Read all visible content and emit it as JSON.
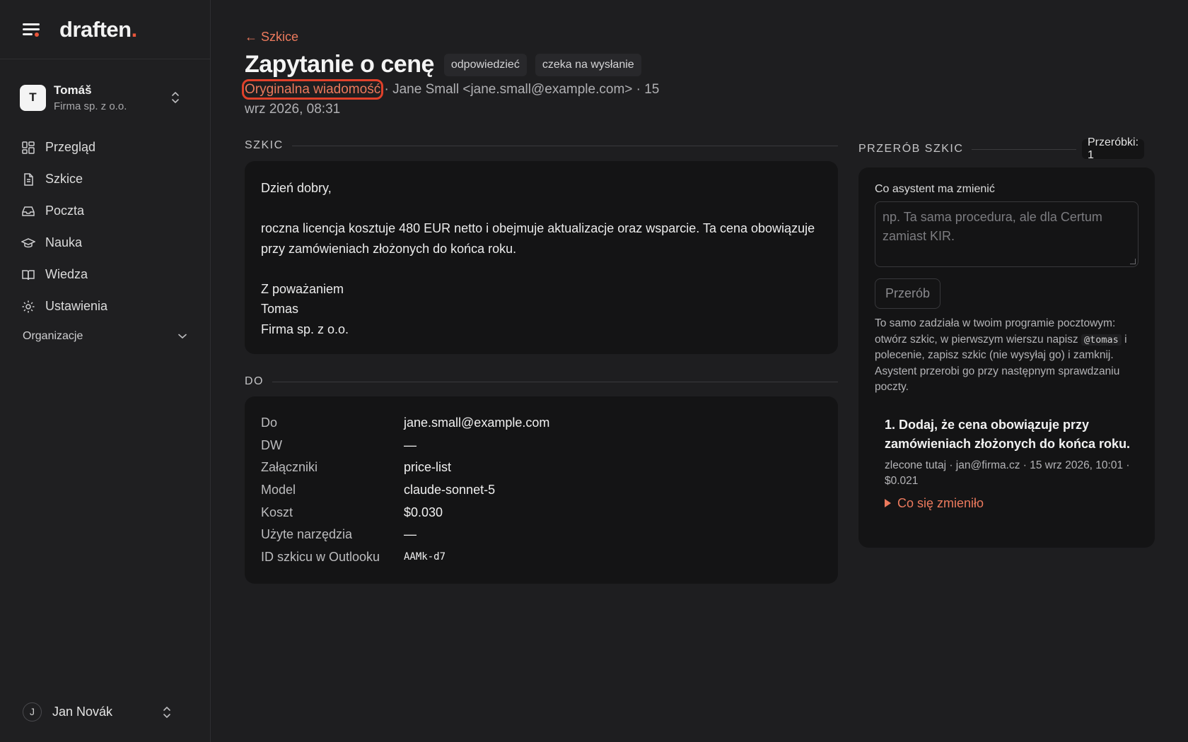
{
  "app": {
    "logo": "draften",
    "logo_dot": "."
  },
  "org": {
    "avatar_letter": "T",
    "name": "Tomáš",
    "company": "Firma sp. z o.o."
  },
  "nav": {
    "items": [
      {
        "label": "Przegląd",
        "icon": "grid-icon"
      },
      {
        "label": "Szkice",
        "icon": "document-icon"
      },
      {
        "label": "Poczta",
        "icon": "inbox-icon"
      },
      {
        "label": "Nauka",
        "icon": "graduation-cap-icon"
      },
      {
        "label": "Wiedza",
        "icon": "book-icon"
      },
      {
        "label": "Ustawienia",
        "icon": "gear-icon"
      }
    ],
    "org_section": "Organizacje"
  },
  "user": {
    "avatar_letter": "J",
    "name": "Jan Novák"
  },
  "page": {
    "back": "← Szkice",
    "title": "Zapytanie o cenę",
    "badges": [
      "odpowiedzieć",
      "czeka na wysłanie"
    ],
    "original_link": "Oryginalna wiadomość",
    "meta_rest": " · Jane Small <jane.small@example.com> · 15 wrz 2026, 08:31"
  },
  "draft": {
    "section": "SZKIC",
    "greeting": "Dzień dobry,",
    "body": "roczna licencja kosztuje 480 EUR netto i obejmuje aktualizacje oraz wsparcie. Ta cena obowiązuje przy zamówieniach złożonych do końca roku.",
    "closing": "Z poważaniem",
    "signature_name": "Tomas",
    "signature_company": "Firma sp. z o.o."
  },
  "details": {
    "section": "DO",
    "rows": [
      {
        "key": "Do",
        "value": "jane.small@example.com"
      },
      {
        "key": "DW",
        "value": "—"
      },
      {
        "key": "Załączniki",
        "value": "price-list"
      },
      {
        "key": "Model",
        "value": "claude-sonnet-5"
      },
      {
        "key": "Koszt",
        "value": "$0.030"
      },
      {
        "key": "Użyte narzędzia",
        "value": "—"
      },
      {
        "key": "ID szkicu w Outlooku",
        "value": "AAMk-d7"
      }
    ]
  },
  "rework": {
    "section": "PRZERÓB SZKIC",
    "count": "Przeróbki: 1",
    "field_label": "Co asystent ma zmienić",
    "placeholder": "np. Ta sama procedura, ale dla Certum zamiast KIR.",
    "button": "Przerób",
    "help_before": "To samo zadziała w twoim programie pocztowym: otwórz szkic, w pierwszym wierszu napisz ",
    "help_code": "@tomas",
    "help_after": " i polecenie, zapisz szkic (nie wysyłaj go) i zamknij. Asystent przerobi go przy następnym sprawdzaniu poczty.",
    "history": [
      {
        "title": "1. Dodaj, że cena obowiązuje przy zamówieniach złożonych do końca roku.",
        "meta": "zlecone tutaj · jan@firma.cz · 15 wrz 2026, 10:01 · $0.021",
        "toggle": "Co się zmieniło"
      }
    ]
  },
  "colors": {
    "accent": "#ec7a5d",
    "logo_dot": "#e8553b",
    "focus_ring": "#e0412a",
    "background": "#1e1e20",
    "card": "#141415"
  }
}
